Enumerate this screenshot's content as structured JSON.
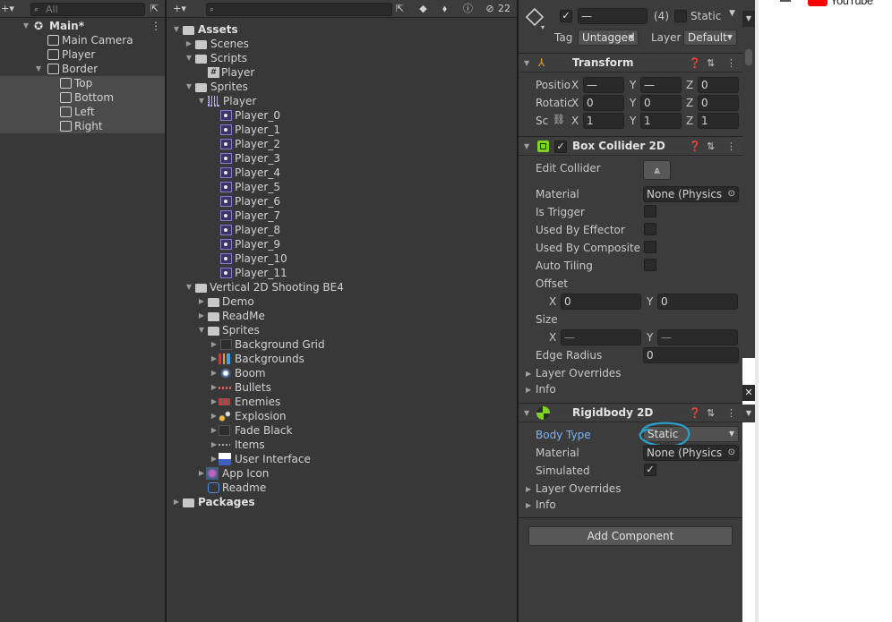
{
  "hierarchy": {
    "search_placeholder": "All",
    "scene_name": "Main*",
    "items": [
      {
        "label": "Main Camera"
      },
      {
        "label": "Player"
      },
      {
        "label": "Border"
      },
      {
        "label": "Top"
      },
      {
        "label": "Bottom"
      },
      {
        "label": "Left"
      },
      {
        "label": "Right"
      }
    ]
  },
  "project": {
    "hidden_count": "22",
    "tree": [
      {
        "label": "Assets"
      },
      {
        "label": "Scenes"
      },
      {
        "label": "Scripts"
      },
      {
        "label": "Player"
      },
      {
        "label": "Sprites"
      },
      {
        "label": "Player"
      },
      {
        "label": "Player_0"
      },
      {
        "label": "Player_1"
      },
      {
        "label": "Player_2"
      },
      {
        "label": "Player_3"
      },
      {
        "label": "Player_4"
      },
      {
        "label": "Player_5"
      },
      {
        "label": "Player_6"
      },
      {
        "label": "Player_7"
      },
      {
        "label": "Player_8"
      },
      {
        "label": "Player_9"
      },
      {
        "label": "Player_10"
      },
      {
        "label": "Player_11"
      },
      {
        "label": "Vertical 2D Shooting BE4"
      },
      {
        "label": "Demo"
      },
      {
        "label": "ReadMe"
      },
      {
        "label": "Sprites"
      },
      {
        "label": "Background Grid"
      },
      {
        "label": "Backgrounds"
      },
      {
        "label": "Boom"
      },
      {
        "label": "Bullets"
      },
      {
        "label": "Enemies"
      },
      {
        "label": "Explosion"
      },
      {
        "label": "Fade Black"
      },
      {
        "label": "Items"
      },
      {
        "label": "User Interface"
      },
      {
        "label": "App Icon"
      },
      {
        "label": "Readme"
      },
      {
        "label": "Packages"
      }
    ]
  },
  "inspector": {
    "header": {
      "name_value": "—",
      "count": "(4)",
      "static_label": "Static",
      "tag_label": "Tag",
      "tag_value": "Untagged",
      "layer_label": "Layer",
      "layer_value": "Default"
    },
    "transform": {
      "title": "Transform",
      "position_label": "Positio",
      "rotation_label": "Rotatic",
      "scale_label": "Sc",
      "x": "X",
      "y": "Y",
      "z": "Z",
      "position": [
        "—",
        "—",
        "0"
      ],
      "rotation": [
        "0",
        "0",
        "0"
      ],
      "scale": [
        "1",
        "1",
        "1"
      ]
    },
    "box_collider": {
      "title": "Box Collider 2D",
      "edit_collider": "Edit Collider",
      "material_label": "Material",
      "material_value": "None (Physics",
      "is_trigger": "Is Trigger",
      "used_by_effector": "Used By Effector",
      "used_by_composite": "Used By Composite",
      "auto_tiling": "Auto Tiling",
      "offset": "Offset",
      "offset_x": "0",
      "offset_y": "0",
      "size": "Size",
      "size_x": "—",
      "size_y": "—",
      "edge_radius_label": "Edge Radius",
      "edge_radius_value": "0",
      "layer_overrides": "Layer Overrides",
      "info": "Info"
    },
    "rigidbody": {
      "title": "Rigidbody 2D",
      "body_type_label": "Body Type",
      "body_type_value": "Static",
      "material_label": "Material",
      "material_value": "None (Physics",
      "simulated_label": "Simulated",
      "layer_overrides": "Layer Overrides",
      "info": "Info"
    },
    "add_component": "Add Component"
  },
  "right_edge": {
    "brand_label": "YouTube"
  },
  "colors": {
    "panel_bg": "#383838",
    "selection": "#4b4b4b",
    "highlight_link": "#7ab4f5",
    "annotation": "#2a9fc9",
    "youtube_red": "#ff0000"
  }
}
